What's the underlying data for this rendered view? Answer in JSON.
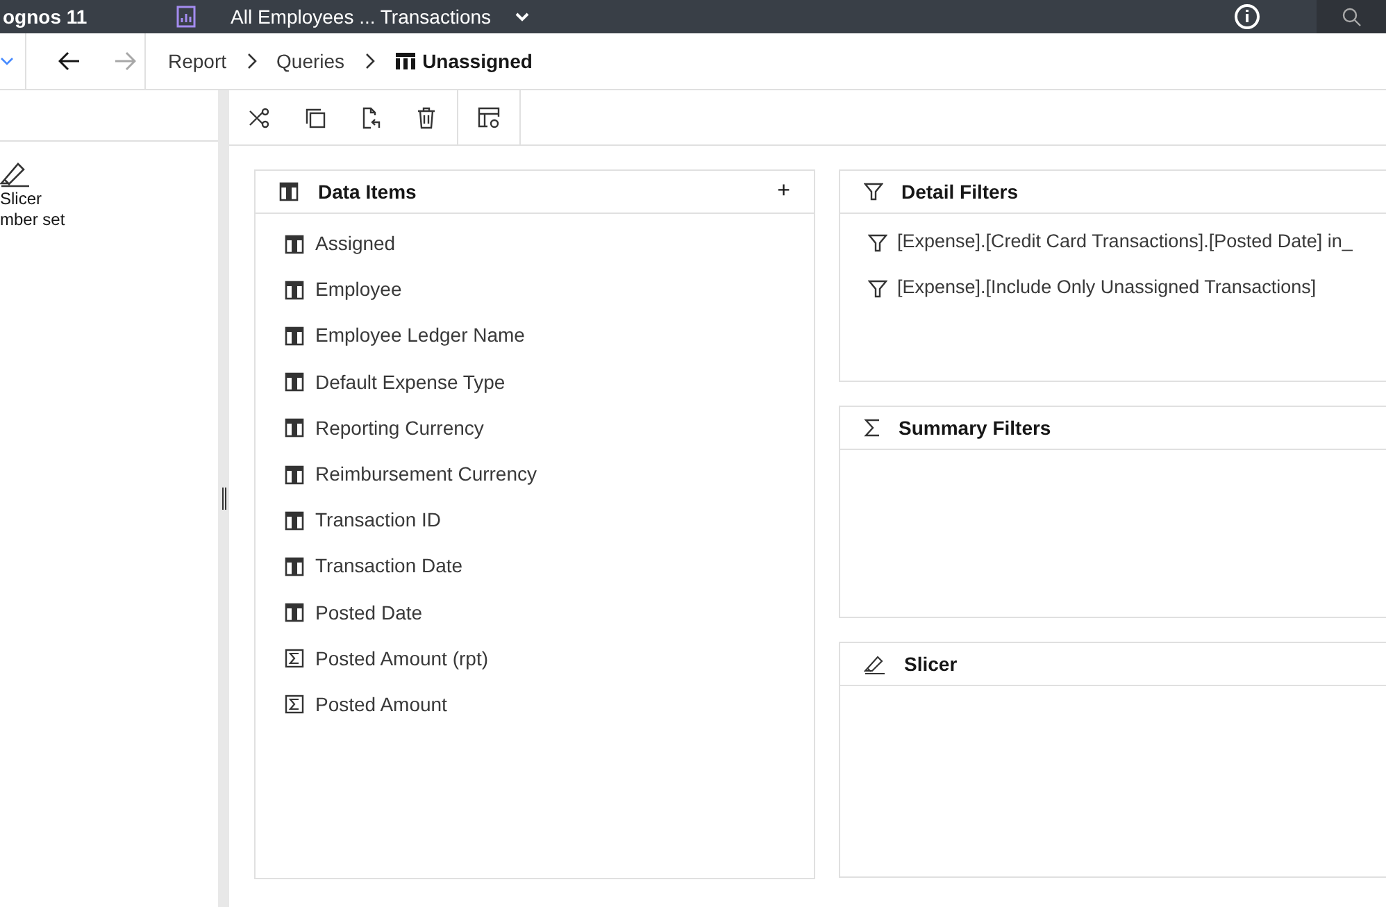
{
  "top_bar": {
    "app_name": "ognos 11",
    "report_title": "All Employees ... Transactions"
  },
  "breadcrumb": [
    {
      "label": "Report",
      "current": false
    },
    {
      "label": "Queries",
      "current": false
    },
    {
      "label": "Unassigned",
      "current": true
    }
  ],
  "palette": {
    "items": [
      {
        "label": "Slicer\nmber set"
      }
    ]
  },
  "data_items": {
    "title": "Data Items",
    "add": "+",
    "items": [
      {
        "label": "Assigned",
        "kind": "column"
      },
      {
        "label": "Employee",
        "kind": "column"
      },
      {
        "label": "Employee Ledger Name",
        "kind": "column"
      },
      {
        "label": "Default Expense Type",
        "kind": "column"
      },
      {
        "label": "Reporting Currency",
        "kind": "column"
      },
      {
        "label": "Reimbursement Currency",
        "kind": "column"
      },
      {
        "label": "Transaction ID",
        "kind": "column"
      },
      {
        "label": "Transaction Date",
        "kind": "column"
      },
      {
        "label": "Posted Date",
        "kind": "column"
      },
      {
        "label": "Posted Amount (rpt)",
        "kind": "measure"
      },
      {
        "label": "Posted Amount",
        "kind": "measure"
      }
    ]
  },
  "panels": [
    {
      "title": "Detail Filters",
      "kind": "filter",
      "items": [
        "[Expense].[Credit Card Transactions].[Posted Date] in_",
        "[Expense].[Include Only Unassigned Transactions]"
      ]
    },
    {
      "title": "Summary Filters",
      "kind": "sum"
    },
    {
      "title": "Slicer",
      "kind": "slicer"
    }
  ]
}
